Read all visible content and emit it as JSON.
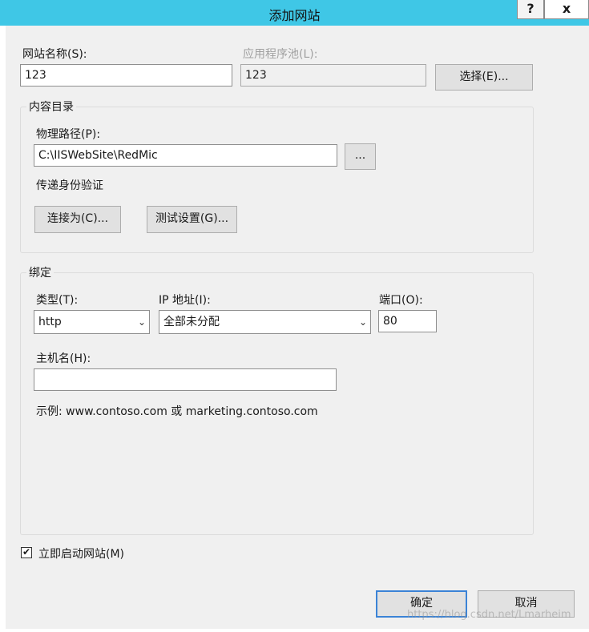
{
  "window": {
    "title": "添加网站",
    "help_label": "?",
    "close_label": "x"
  },
  "site": {
    "name_label": "网站名称(S):",
    "name_value": "123",
    "pool_label": "应用程序池(L):",
    "pool_value": "123",
    "select_button": "选择(E)..."
  },
  "content": {
    "group_title": "内容目录",
    "path_label": "物理路径(P):",
    "path_value": "C:\\IISWebSite\\RedMic",
    "browse_button": "...",
    "auth_label": "传递身份验证",
    "connect_button": "连接为(C)...",
    "test_button": "测试设置(G)..."
  },
  "binding": {
    "group_title": "绑定",
    "type_label": "类型(T):",
    "type_value": "http",
    "ip_label": "IP 地址(I):",
    "ip_value": "全部未分配",
    "port_label": "端口(O):",
    "port_value": "80",
    "host_label": "主机名(H):",
    "host_value": "",
    "example_text": "示例: www.contoso.com 或 marketing.contoso.com"
  },
  "start": {
    "checkbox_label": "立即启动网站(M)",
    "checked": true,
    "check_glyph": "✔"
  },
  "footer": {
    "ok_button": "确定",
    "cancel_button": "取消",
    "watermark": "https://blog.csdn.net/Lmarheim"
  }
}
